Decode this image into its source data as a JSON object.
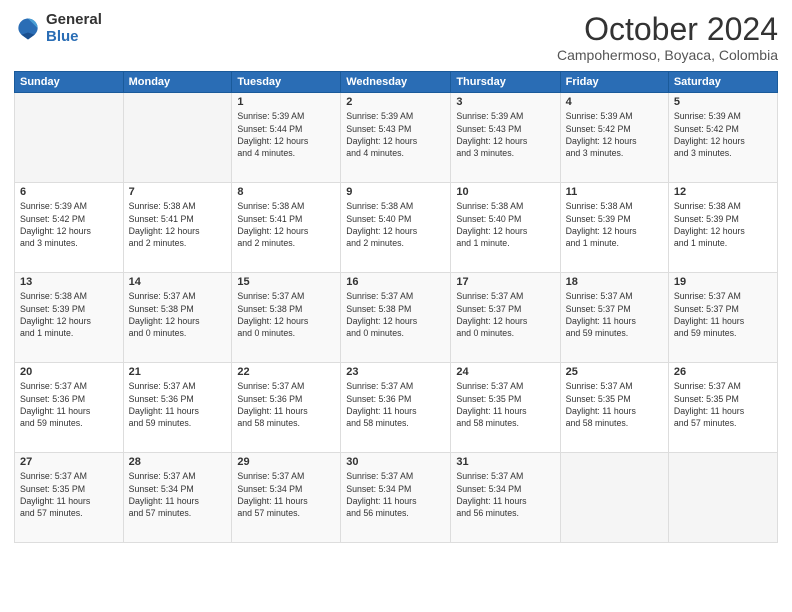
{
  "logo": {
    "general": "General",
    "blue": "Blue"
  },
  "title": "October 2024",
  "subtitle": "Campohermoso, Boyaca, Colombia",
  "days_of_week": [
    "Sunday",
    "Monday",
    "Tuesday",
    "Wednesday",
    "Thursday",
    "Friday",
    "Saturday"
  ],
  "weeks": [
    [
      {
        "day": "",
        "info": ""
      },
      {
        "day": "",
        "info": ""
      },
      {
        "day": "1",
        "info": "Sunrise: 5:39 AM\nSunset: 5:44 PM\nDaylight: 12 hours\nand 4 minutes."
      },
      {
        "day": "2",
        "info": "Sunrise: 5:39 AM\nSunset: 5:43 PM\nDaylight: 12 hours\nand 4 minutes."
      },
      {
        "day": "3",
        "info": "Sunrise: 5:39 AM\nSunset: 5:43 PM\nDaylight: 12 hours\nand 3 minutes."
      },
      {
        "day": "4",
        "info": "Sunrise: 5:39 AM\nSunset: 5:42 PM\nDaylight: 12 hours\nand 3 minutes."
      },
      {
        "day": "5",
        "info": "Sunrise: 5:39 AM\nSunset: 5:42 PM\nDaylight: 12 hours\nand 3 minutes."
      }
    ],
    [
      {
        "day": "6",
        "info": "Sunrise: 5:39 AM\nSunset: 5:42 PM\nDaylight: 12 hours\nand 3 minutes."
      },
      {
        "day": "7",
        "info": "Sunrise: 5:38 AM\nSunset: 5:41 PM\nDaylight: 12 hours\nand 2 minutes."
      },
      {
        "day": "8",
        "info": "Sunrise: 5:38 AM\nSunset: 5:41 PM\nDaylight: 12 hours\nand 2 minutes."
      },
      {
        "day": "9",
        "info": "Sunrise: 5:38 AM\nSunset: 5:40 PM\nDaylight: 12 hours\nand 2 minutes."
      },
      {
        "day": "10",
        "info": "Sunrise: 5:38 AM\nSunset: 5:40 PM\nDaylight: 12 hours\nand 1 minute."
      },
      {
        "day": "11",
        "info": "Sunrise: 5:38 AM\nSunset: 5:39 PM\nDaylight: 12 hours\nand 1 minute."
      },
      {
        "day": "12",
        "info": "Sunrise: 5:38 AM\nSunset: 5:39 PM\nDaylight: 12 hours\nand 1 minute."
      }
    ],
    [
      {
        "day": "13",
        "info": "Sunrise: 5:38 AM\nSunset: 5:39 PM\nDaylight: 12 hours\nand 1 minute."
      },
      {
        "day": "14",
        "info": "Sunrise: 5:37 AM\nSunset: 5:38 PM\nDaylight: 12 hours\nand 0 minutes."
      },
      {
        "day": "15",
        "info": "Sunrise: 5:37 AM\nSunset: 5:38 PM\nDaylight: 12 hours\nand 0 minutes."
      },
      {
        "day": "16",
        "info": "Sunrise: 5:37 AM\nSunset: 5:38 PM\nDaylight: 12 hours\nand 0 minutes."
      },
      {
        "day": "17",
        "info": "Sunrise: 5:37 AM\nSunset: 5:37 PM\nDaylight: 12 hours\nand 0 minutes."
      },
      {
        "day": "18",
        "info": "Sunrise: 5:37 AM\nSunset: 5:37 PM\nDaylight: 11 hours\nand 59 minutes."
      },
      {
        "day": "19",
        "info": "Sunrise: 5:37 AM\nSunset: 5:37 PM\nDaylight: 11 hours\nand 59 minutes."
      }
    ],
    [
      {
        "day": "20",
        "info": "Sunrise: 5:37 AM\nSunset: 5:36 PM\nDaylight: 11 hours\nand 59 minutes."
      },
      {
        "day": "21",
        "info": "Sunrise: 5:37 AM\nSunset: 5:36 PM\nDaylight: 11 hours\nand 59 minutes."
      },
      {
        "day": "22",
        "info": "Sunrise: 5:37 AM\nSunset: 5:36 PM\nDaylight: 11 hours\nand 58 minutes."
      },
      {
        "day": "23",
        "info": "Sunrise: 5:37 AM\nSunset: 5:36 PM\nDaylight: 11 hours\nand 58 minutes."
      },
      {
        "day": "24",
        "info": "Sunrise: 5:37 AM\nSunset: 5:35 PM\nDaylight: 11 hours\nand 58 minutes."
      },
      {
        "day": "25",
        "info": "Sunrise: 5:37 AM\nSunset: 5:35 PM\nDaylight: 11 hours\nand 58 minutes."
      },
      {
        "day": "26",
        "info": "Sunrise: 5:37 AM\nSunset: 5:35 PM\nDaylight: 11 hours\nand 57 minutes."
      }
    ],
    [
      {
        "day": "27",
        "info": "Sunrise: 5:37 AM\nSunset: 5:35 PM\nDaylight: 11 hours\nand 57 minutes."
      },
      {
        "day": "28",
        "info": "Sunrise: 5:37 AM\nSunset: 5:34 PM\nDaylight: 11 hours\nand 57 minutes."
      },
      {
        "day": "29",
        "info": "Sunrise: 5:37 AM\nSunset: 5:34 PM\nDaylight: 11 hours\nand 57 minutes."
      },
      {
        "day": "30",
        "info": "Sunrise: 5:37 AM\nSunset: 5:34 PM\nDaylight: 11 hours\nand 56 minutes."
      },
      {
        "day": "31",
        "info": "Sunrise: 5:37 AM\nSunset: 5:34 PM\nDaylight: 11 hours\nand 56 minutes."
      },
      {
        "day": "",
        "info": ""
      },
      {
        "day": "",
        "info": ""
      }
    ]
  ]
}
